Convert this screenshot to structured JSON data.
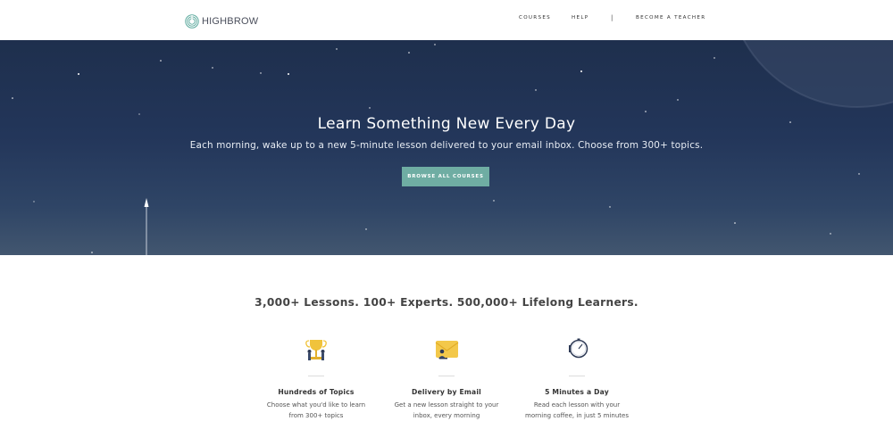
{
  "nav": {
    "logo_text": "HIGHBROW",
    "links": [
      "COURSES",
      "HELP",
      "BECOME A TEACHER"
    ],
    "separator": "|"
  },
  "hero": {
    "title": "Learn Something New Every Day",
    "subtitle": "Each morning, wake up to a new 5-minute lesson delivered to your email inbox. Choose from 300+ topics.",
    "button_label": "BROWSE ALL COURSES"
  },
  "tagline": "3,000+ Lessons. 100+ Experts. 500,000+ Lifelong Learners.",
  "features": [
    {
      "icon": "trophy-icon",
      "title": "Hundreds of Topics",
      "desc_line1": "Choose what you'd like to learn",
      "desc_line2": "from 300+ topics"
    },
    {
      "icon": "email-icon",
      "title": "Delivery by Email",
      "desc_line1": "Get a new lesson straight to your",
      "desc_line2": "inbox, every morning"
    },
    {
      "icon": "stopwatch-icon",
      "title": "5 Minutes a Day",
      "desc_line1": "Read each lesson with your",
      "desc_line2": "morning coffee, in just 5 minutes"
    }
  ],
  "colors": {
    "hero_bg": "#23365a",
    "button_bg": "#6fada3",
    "logo_teal": "#5aa89c"
  }
}
